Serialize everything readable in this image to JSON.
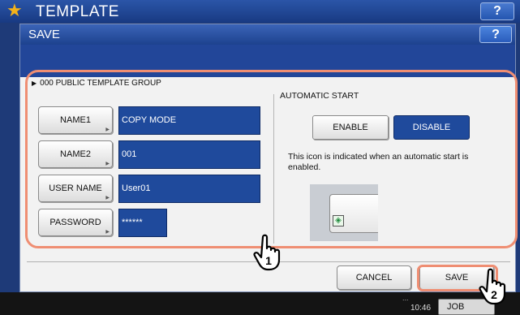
{
  "background": {
    "title": "TEMPLATE",
    "help_label": "?",
    "counter_text": "...",
    "time": "10:46",
    "job_status_label": "JOB STATUS"
  },
  "dialog": {
    "title": "SAVE",
    "help_label": "?",
    "group_label": "000 PUBLIC TEMPLATE GROUP",
    "fields": [
      {
        "label": "NAME1",
        "value": "COPY MODE"
      },
      {
        "label": "NAME2",
        "value": "001"
      },
      {
        "label": "USER NAME",
        "value": "User01"
      },
      {
        "label": "PASSWORD",
        "value": "******"
      }
    ],
    "automatic_start": {
      "title": "AUTOMATIC START",
      "enable_label": "ENABLE",
      "disable_label": "DISABLE",
      "selected": "DISABLE",
      "description": "This icon is indicated when an automatic start is enabled."
    },
    "cancel_label": "CANCEL",
    "save_label": "SAVE"
  },
  "callouts": {
    "step1": "1",
    "step2": "2"
  },
  "colors": {
    "accent_blue": "#1f4a9c",
    "highlight": "#ef8e73",
    "star": "#f3b21a"
  }
}
